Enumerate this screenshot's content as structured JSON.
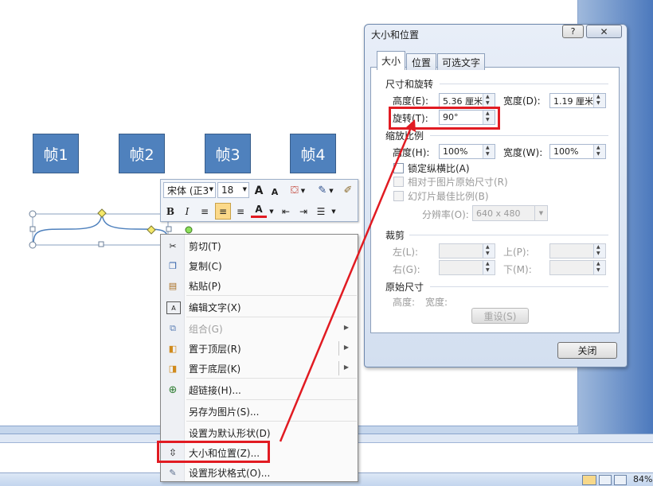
{
  "slide": {
    "frames": [
      "帧1",
      "帧2",
      "帧3",
      "帧4"
    ]
  },
  "mini_toolbar": {
    "font_name": "宋体 (正3",
    "font_size": "18",
    "bold": "B",
    "italic": "I",
    "font_color_letter": "A",
    "grow_font": "A",
    "shrink_font": "A"
  },
  "context_menu": {
    "items": [
      {
        "label": "剪切(T)",
        "icon": "scissors-icon"
      },
      {
        "label": "复制(C)",
        "icon": "copy-icon"
      },
      {
        "label": "粘贴(P)",
        "icon": "paste-icon"
      },
      {
        "label": "编辑文字(X)",
        "icon": "edit-text-icon"
      },
      {
        "label": "组合(G)",
        "icon": "group-icon",
        "disabled": true
      },
      {
        "label": "置于顶层(R)",
        "icon": "bring-to-front-icon"
      },
      {
        "label": "置于底层(K)",
        "icon": "send-to-back-icon"
      },
      {
        "label": "超链接(H)...",
        "icon": "hyperlink-icon"
      },
      {
        "label": "另存为图片(S)...",
        "icon": ""
      },
      {
        "label": "设置为默认形状(D)",
        "icon": ""
      },
      {
        "label": "大小和位置(Z)...",
        "icon": "size-position-icon"
      },
      {
        "label": "设置形状格式(O)...",
        "icon": "format-shape-icon"
      }
    ]
  },
  "dialog": {
    "title": "大小和位置",
    "help": "?",
    "tabs": [
      "大小",
      "位置",
      "可选文字"
    ],
    "size_rotate": {
      "section": "尺寸和旋转",
      "height_label": "高度(E):",
      "height_value": "5.36 厘米",
      "width_label": "宽度(D):",
      "width_value": "1.19 厘米",
      "rotate_label": "旋转(T):",
      "rotate_value": "90°"
    },
    "scale": {
      "section": "缩放比例",
      "height_label": "高度(H):",
      "height_value": "100%",
      "width_label": "宽度(W):",
      "width_value": "100%",
      "lock_aspect": "锁定纵横比(A)",
      "relative_original": "相对于图片原始尺寸(R)",
      "best_scale": "幻灯片最佳比例(B)",
      "resolution_label": "分辨率(O):",
      "resolution_value": "640 x 480"
    },
    "crop": {
      "section": "裁剪",
      "left": "左(L):",
      "right": "右(G):",
      "top": "上(P):",
      "bottom": "下(M):"
    },
    "original": {
      "section": "原始尺寸",
      "height": "高度:",
      "width": "宽度:",
      "reset": "重设(S)"
    },
    "close": "关闭"
  },
  "status": {
    "zoom": "84%"
  },
  "colors": {
    "accent_red": "#e11b22",
    "frame_blue": "#4f81bd"
  }
}
